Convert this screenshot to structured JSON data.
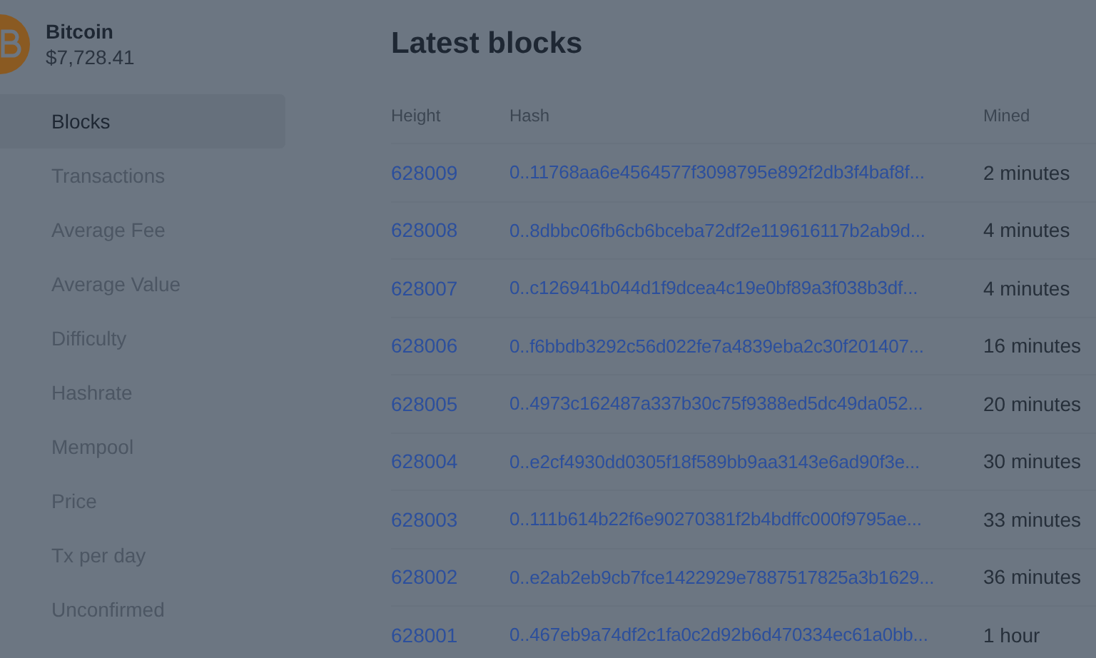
{
  "asset": {
    "name": "Bitcoin",
    "price": "$7,728.41"
  },
  "nav": [
    {
      "label": "Blocks",
      "selected": true
    },
    {
      "label": "Transactions",
      "selected": false
    },
    {
      "label": "Average Fee",
      "selected": false
    },
    {
      "label": "Average Value",
      "selected": false
    },
    {
      "label": "Difficulty",
      "selected": false
    },
    {
      "label": "Hashrate",
      "selected": false
    },
    {
      "label": "Mempool",
      "selected": false
    },
    {
      "label": "Price",
      "selected": false
    },
    {
      "label": "Tx per day",
      "selected": false
    },
    {
      "label": "Unconfirmed",
      "selected": false
    }
  ],
  "title": "Latest blocks",
  "table": {
    "columns": [
      "Height",
      "Hash",
      "Mined"
    ],
    "rows": [
      [
        "628009",
        "0..11768aa6e4564577f3098795e892f2db3f4baf8f...",
        "2 minutes"
      ],
      [
        "628008",
        "0..8dbbc06fb6cb6bceba72df2e119616117b2ab9d...",
        "4 minutes"
      ],
      [
        "628007",
        "0..c126941b044d1f9dcea4c19e0bf89a3f038b3df...",
        "4 minutes"
      ],
      [
        "628006",
        "0..f6bbdb3292c56d022fe7a4839eba2c30f201407...",
        "16 minutes"
      ],
      [
        "628005",
        "0..4973c162487a337b30c75f9388ed5dc49da052...",
        "20 minutes"
      ],
      [
        "628004",
        "0..e2cf4930dd0305f18f589bb9aa3143e6ad90f3e...",
        "30 minutes"
      ],
      [
        "628003",
        "0..111b614b22f6e90270381f2b4bdffc000f9795ae...",
        "33 minutes"
      ],
      [
        "628002",
        "0..e2ab2eb9cb7fce1422929e7887517825a3b1629...",
        "36 minutes"
      ],
      [
        "628001",
        "0..467eb9a74df2c1fa0c2d92b6d470334ec61a0bb...",
        "1 hour"
      ]
    ]
  }
}
